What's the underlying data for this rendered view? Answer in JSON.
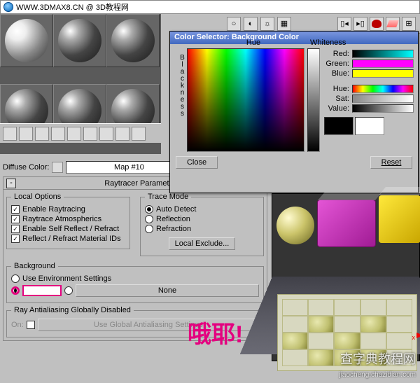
{
  "url_text": "WWW.3DMAX8.CN @ 3D教程网",
  "diffuse_label": "Diffuse Color:",
  "diffuse_map": "Map #10",
  "rollup_title": "Raytracer Parameters",
  "local_options": {
    "legend": "Local Options",
    "opt1": "Enable Raytracing",
    "opt2": "Raytrace Atmospherics",
    "opt3": "Enable Self Reflect / Refract",
    "opt4": "Reflect / Refract Material IDs"
  },
  "trace_mode": {
    "legend": "Trace Mode",
    "opt1": "Auto Detect",
    "opt2": "Reflection",
    "opt3": "Refraction",
    "btn": "Local Exclude..."
  },
  "background": {
    "legend": "Background",
    "env": "Use Environment Settings",
    "none": "None"
  },
  "antialias": {
    "legend": "Ray Antialiasing Globally Disabled",
    "on": "On:",
    "btn": "Use Global Antialiasing Settings"
  },
  "color_selector": {
    "title": "Color Selector: Background Color",
    "hue": "Hue",
    "whiteness": "Whiteness",
    "blackness": "Blackness",
    "red": "Red:",
    "green": "Green:",
    "blue": "Blue:",
    "hue2": "Hue:",
    "sat": "Sat:",
    "value": "Value:",
    "close": "Close",
    "reset": "Reset",
    "colors": {
      "red_bar": "linear-gradient(to right,#000,#0ff)",
      "green_bar": "linear-gradient(to right,#f0f,#f0f)",
      "blue_bar": "linear-gradient(to right,#ff0,#ff0)",
      "hue_bar": "linear-gradient(to right,red,#ff0,#0f0,#0ff,#00f,#f0f,red)",
      "sat_bar": "linear-gradient(to right,#888,#fff)",
      "val_bar": "linear-gradient(to right,#000,#fff)"
    }
  },
  "annotation": "哦耶!",
  "watermark1": "查字典教程网",
  "watermark2": "jiaocheng.chazidian.com",
  "axis_label": "x"
}
